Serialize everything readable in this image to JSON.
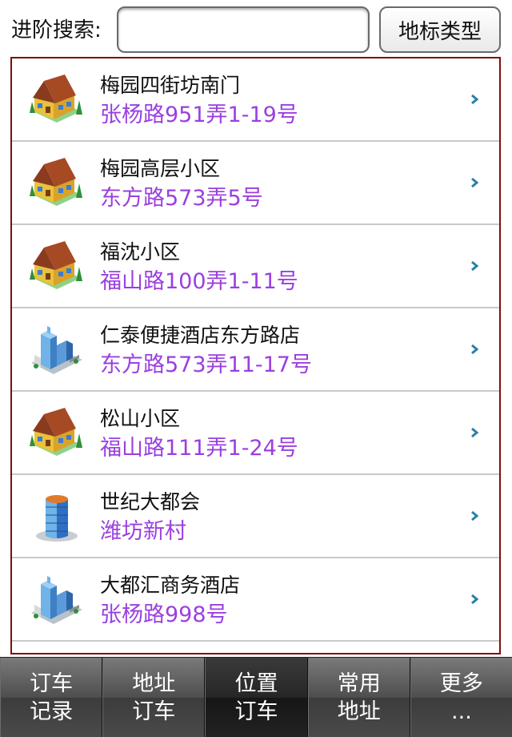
{
  "search": {
    "label": "进阶搜索:",
    "input_value": "",
    "placeholder": "",
    "type_button_label": "地标类型"
  },
  "results": [
    {
      "title": "梅园四街坊南门",
      "address": "张杨路951弄1-19号",
      "icon": "house-icon"
    },
    {
      "title": "梅园高层小区",
      "address": "东方路573弄5号",
      "icon": "house-icon"
    },
    {
      "title": "福沈小区",
      "address": "福山路100弄1-11号",
      "icon": "house-icon"
    },
    {
      "title": "仁泰便捷酒店东方路店",
      "address": "东方路573弄11-17号",
      "icon": "building-icon"
    },
    {
      "title": "松山小区",
      "address": "福山路111弄1-24号",
      "icon": "house-icon"
    },
    {
      "title": "世纪大都会",
      "address": "潍坊新村",
      "icon": "tower-icon"
    },
    {
      "title": "大都汇商务酒店",
      "address": "张杨路998号",
      "icon": "building-icon"
    }
  ],
  "tabs": [
    {
      "line1": "订车",
      "line2": "记录"
    },
    {
      "line1": "地址",
      "line2": "订车"
    },
    {
      "line1": "位置",
      "line2": "订车"
    },
    {
      "line1": "常用",
      "line2": "地址"
    },
    {
      "line1": "更多",
      "line2": "..."
    }
  ],
  "colors": {
    "address_text": "#9b3fe0",
    "list_border": "#7a0f0f",
    "chevron": "#2a7fa8"
  }
}
